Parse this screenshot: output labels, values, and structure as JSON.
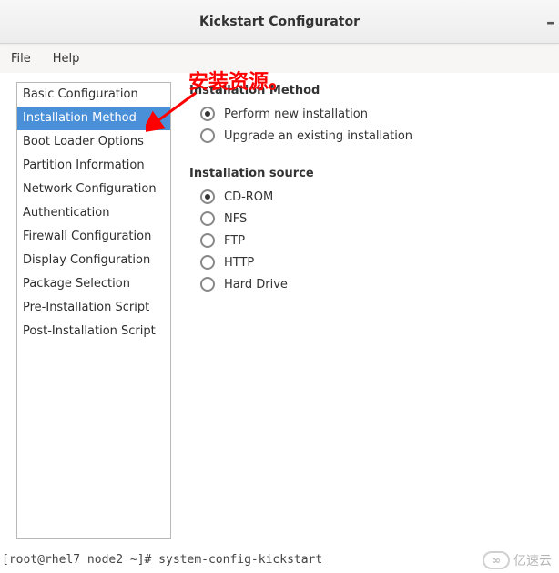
{
  "window": {
    "title": "Kickstart Configurator"
  },
  "menubar": {
    "file": "File",
    "help": "Help"
  },
  "annotation": {
    "text": "安装资源。"
  },
  "sidebar": {
    "items": [
      {
        "label": "Basic Configuration"
      },
      {
        "label": "Installation Method"
      },
      {
        "label": "Boot Loader Options"
      },
      {
        "label": "Partition Information"
      },
      {
        "label": "Network Configuration"
      },
      {
        "label": "Authentication"
      },
      {
        "label": "Firewall Configuration"
      },
      {
        "label": "Display Configuration"
      },
      {
        "label": "Package Selection"
      },
      {
        "label": "Pre-Installation Script"
      },
      {
        "label": "Post-Installation Script"
      }
    ],
    "selected_index": 1
  },
  "main": {
    "method_title": "Installation Method",
    "method_options": {
      "perform": "Perform new installation",
      "upgrade": "Upgrade an existing installation"
    },
    "source_title": "Installation source",
    "source_options": {
      "cdrom": "CD-ROM",
      "nfs": "NFS",
      "ftp": "FTP",
      "http": "HTTP",
      "harddrive": "Hard Drive"
    }
  },
  "terminal": {
    "line": "[root@rhel7 node2 ~]# system-config-kickstart"
  },
  "watermark": {
    "text": "亿速云",
    "cloud": "∞"
  }
}
